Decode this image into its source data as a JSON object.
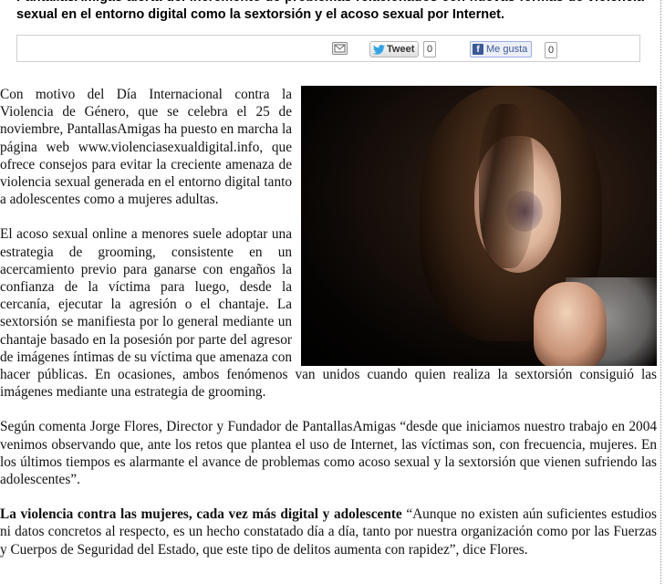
{
  "lead": "PantallasAmigas alerta del incremento de problemas relacionados con nuevas formas de violencia sexual en el entorno digital como la sextorsión y el acoso sexual por Internet.",
  "share": {
    "email_icon": "envelope-icon",
    "tweet_label": "Tweet",
    "tweet_count": "0",
    "like_label": "Me gusta",
    "like_count": "0"
  },
  "image": {
    "subject": "Girl with long hair and a bruised face, praying with clasped hands on a dark background"
  },
  "article": {
    "p1": "Con motivo del Día Internacional contra la Violencia de Género, que se celebra el 25 de noviembre, PantallasAmigas ha puesto en marcha la página web www.violenciasexualdigital.info, que ofrece consejos para evitar la creciente amenaza de violencia sexual generada en el entorno digital tanto a adolescentes como a mujeres adultas.",
    "p2": "El acoso sexual online a menores suele adoptar una estrategia de grooming, consistente en un acercamiento previo para ganarse con engaños la confianza de la víctima para luego, desde la cercanía, ejecutar la agresión o el chantaje. La sextorsión se manifiesta por lo general mediante un chantaje basado en la posesión por parte del agresor de imágenes íntimas de su víctima que amenaza con hacer públicas. En ocasiones, ambos fenómenos van unidos cuando quien realiza la sextorsión consiguió las imágenes mediante una estrategia de grooming.",
    "p3": "Según comenta Jorge Flores, Director y Fundador de PantallasAmigas “desde que iniciamos nuestro trabajo en 2004 venimos observando que, ante los retos que plantea el uso de Internet, las víctimas son, con frecuencia, mujeres. En los últimos tiempos es alarmante el avance de problemas como acoso sexual y la sextorsión que vienen sufriendo las adolescentes”.",
    "p4_heading": "La violencia contra las mujeres, cada vez más digital y adolescente",
    "p4_body": " “Aunque no existen aún suficientes estudios ni datos concretos al respecto, es un hecho constatado día a día, tanto por nuestra organización como por las Fuerzas y Cuerpos de Seguridad del Estado, que este tipo de delitos aumenta con rapidez”, dice Flores."
  }
}
